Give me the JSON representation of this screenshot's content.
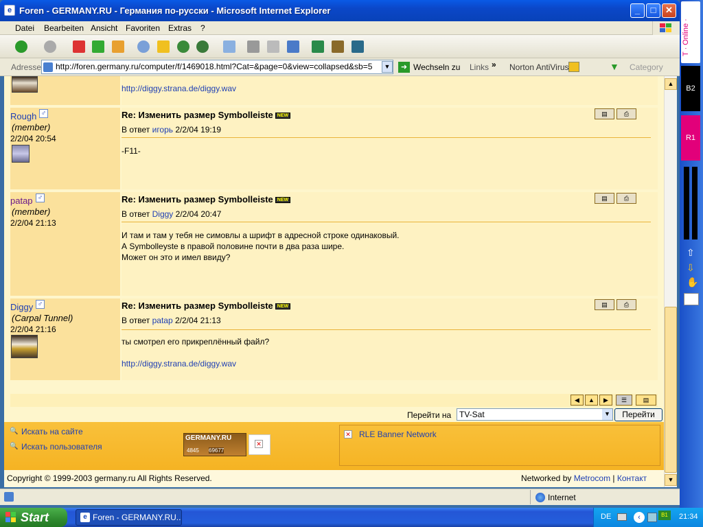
{
  "window": {
    "title": "Foren - GERMANY.RU - Германия по-русски - Microsoft Internet Explorer"
  },
  "menu": [
    "Datei",
    "Bearbeiten",
    "Ansicht",
    "Favoriten",
    "Extras",
    "?"
  ],
  "address": {
    "label": "Adresse",
    "url": "http://foren.germany.ru/computer/f/1469018.html?Cat=&page=0&view=collapsed&sb=5",
    "go": "Wechseln zu",
    "links": "Links",
    "norton": "Norton AntiVirus",
    "category": "Category"
  },
  "top_link": "http://diggy.strana.de/diggy.wav",
  "posts": [
    {
      "user": "Rough",
      "role": "(member)",
      "date": "2/2/04 20:54",
      "title": "Re: Изменить размер Symbolleiste",
      "reply_prefix": "В ответ",
      "reply_user": "игорь",
      "reply_date": "2/2/04 19:19",
      "body": [
        "-F11-"
      ],
      "link": ""
    },
    {
      "user": "patap",
      "role": "(member)",
      "date": "2/2/04 21:13",
      "title": "Re: Изменить размер Symbolleiste",
      "reply_prefix": "В ответ",
      "reply_user": "Diggy",
      "reply_date": "2/2/04 20:47",
      "body": [
        "И там и там у тебя не симовлы а шрифт в адресной строке одинаковый.",
        "А Symbolleyste в правой половине почти в два раза шире.",
        "Может он это и имел ввиду?"
      ],
      "link": ""
    },
    {
      "user": "Diggy",
      "role": "(Carpal Tunnel)",
      "date": "2/2/04 21:16",
      "title": "Re: Изменить размер Symbolleiste",
      "reply_prefix": "В ответ",
      "reply_user": "patap",
      "reply_date": "2/2/04 21:13",
      "body": [
        "ты смотрел его прикреплённый файл?"
      ],
      "link": "http://diggy.strana.de/diggy.wav"
    }
  ],
  "goto": {
    "label": "Перейти на",
    "selected": "TV-Sat",
    "button": "Перейти"
  },
  "footer": {
    "search_site": "Искать на сайте",
    "search_user": "Искать пользователя",
    "banner": "RLE Banner Network",
    "counter_brand": "GERMANY.RU",
    "counter1": "4845",
    "counter2": "69677",
    "copyright": "Copyright © 1999-2003 germany.ru All Rights Reserved.",
    "networked": "Networked by",
    "metrocom": "Metrocom",
    "sep": "|",
    "contact": "Контакт"
  },
  "status": {
    "zone": "Internet"
  },
  "taskbar": {
    "start": "Start",
    "task": "Foren - GERMANY.RU...",
    "lang": "DE",
    "time": "21:34"
  },
  "sidebar": {
    "brand": "T · Online ·",
    "b2": "B2",
    "r1": "R1"
  },
  "new_badge": "NEW"
}
